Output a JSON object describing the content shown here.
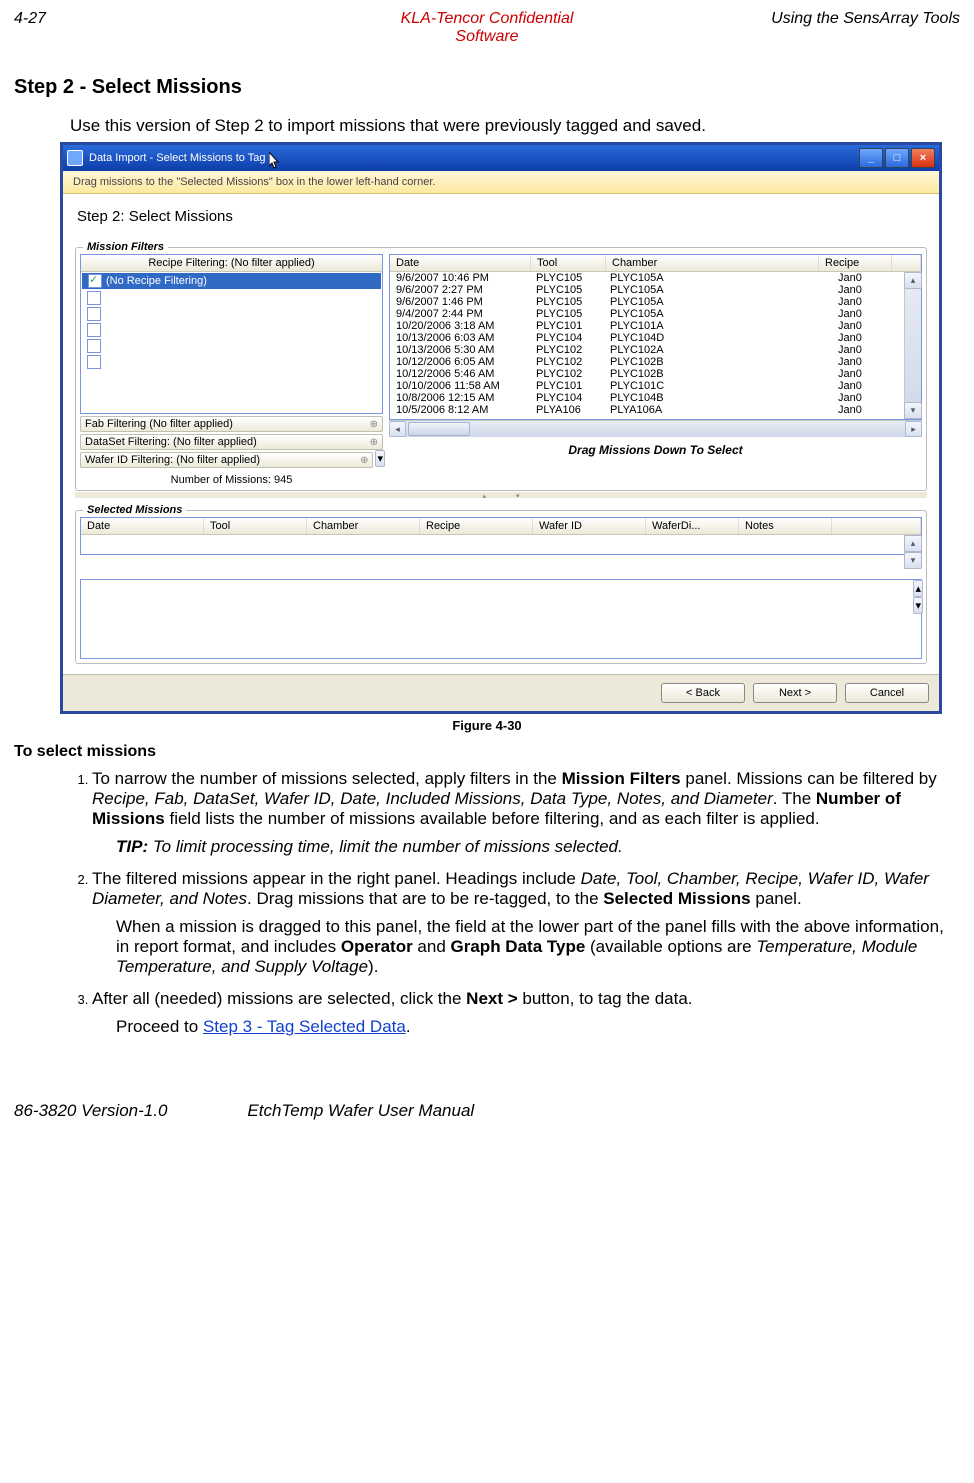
{
  "header": {
    "page_no": "4-27",
    "center_line1": "KLA-Tencor Confidential",
    "center_line2": "Software",
    "right": "Using the SensArray Tools"
  },
  "title": "Step 2 - Select Missions",
  "intro": "Use this version of Step 2 to import missions that were previously tagged and saved.",
  "window": {
    "title": "Data Import - Select Missions to Tag",
    "info_banner": "Drag missions to the \"Selected Missions\" box in the lower left-hand corner.",
    "step_label": "Step 2: Select Missions",
    "filters_legend": "Mission Filters",
    "recipe_filter_header": "Recipe Filtering: (No filter applied)",
    "recipe_selected": "(No Recipe Filtering)",
    "fab_filter": "Fab Filtering (No filter applied)",
    "dataset_filter": "DataSet Filtering: (No filter applied)",
    "waferid_filter": "Wafer ID Filtering: (No filter applied)",
    "num_missions": "Number of Missions: 945",
    "mcols": {
      "date": "Date",
      "tool": "Tool",
      "chamber": "Chamber",
      "recipe": "Recipe"
    },
    "rows": [
      {
        "date": "9/6/2007 10:46 PM",
        "tool": "PLYC105",
        "chamber": "PLYC105A",
        "recipe": "Jan0"
      },
      {
        "date": "9/6/2007 2:27 PM",
        "tool": "PLYC105",
        "chamber": "PLYC105A",
        "recipe": "Jan0"
      },
      {
        "date": "9/6/2007 1:46 PM",
        "tool": "PLYC105",
        "chamber": "PLYC105A",
        "recipe": "Jan0"
      },
      {
        "date": "9/4/2007 2:44 PM",
        "tool": "PLYC105",
        "chamber": "PLYC105A",
        "recipe": "Jan0"
      },
      {
        "date": "10/20/2006 3:18 AM",
        "tool": "PLYC101",
        "chamber": "PLYC101A",
        "recipe": "Jan0"
      },
      {
        "date": "10/13/2006 6:03 AM",
        "tool": "PLYC104",
        "chamber": "PLYC104D",
        "recipe": "Jan0"
      },
      {
        "date": "10/13/2006 5:30 AM",
        "tool": "PLYC102",
        "chamber": "PLYC102A",
        "recipe": "Jan0"
      },
      {
        "date": "10/12/2006 6:05 AM",
        "tool": "PLYC102",
        "chamber": "PLYC102B",
        "recipe": "Jan0"
      },
      {
        "date": "10/12/2006 5:46 AM",
        "tool": "PLYC102",
        "chamber": "PLYC102B",
        "recipe": "Jan0"
      },
      {
        "date": "10/10/2006 11:58 AM",
        "tool": "PLYC101",
        "chamber": "PLYC101C",
        "recipe": "Jan0"
      },
      {
        "date": "10/8/2006 12:15 AM",
        "tool": "PLYC104",
        "chamber": "PLYC104B",
        "recipe": "Jan0"
      },
      {
        "date": "10/5/2006 8:12 AM",
        "tool": "PLYA106",
        "chamber": "PLYA106A",
        "recipe": "Jan0"
      }
    ],
    "drag_hint": "Drag Missions Down To Select",
    "selected_legend": "Selected Missions",
    "scols": {
      "date": "Date",
      "tool": "Tool",
      "chamber": "Chamber",
      "recipe": "Recipe",
      "waferid": "Wafer ID",
      "waferdi": "WaferDi...",
      "notes": "Notes"
    },
    "buttons": {
      "back": "< Back",
      "next": "Next >",
      "cancel": "Cancel"
    }
  },
  "figure_caption": "Figure 4-30",
  "subhead": "To select missions",
  "steps": {
    "s1a": "To narrow the number of missions selected, apply filters in the ",
    "s1b": "Mission Filters",
    "s1c": " panel. Missions can be filtered by ",
    "s1_list": "Recipe, Fab, DataSet, Wafer ID, Date, Included Missions, Data Type, Notes, and Diameter",
    "s1d": ". The ",
    "s1e": "Number of Missions",
    "s1f": " field lists the number of missions available before filtering, and as each filter is applied.",
    "tip_label": "TIP:",
    "tip_text": " To limit processing time, limit the number of missions selected.",
    "s2a": "The filtered missions appear in the right panel. Headings include ",
    "s2_list": "Date, Tool, Chamber, Recipe, Wafer ID, Wafer Diameter, and Notes",
    "s2b": ". Drag missions that are to be re-tagged, to the ",
    "s2c": "Selected Missions",
    "s2d": " panel.",
    "s2e": "When a mission is dragged to this panel, the field at the lower part of the panel fills with the above information, in report format, and includes ",
    "s2f": "Operator",
    "s2g": " and ",
    "s2h": "Graph Data Type",
    "s2i": " (available options are ",
    "s2_opts": "Temperature, Module Temperature, and Supply Voltage",
    "s2j": ").",
    "s3a": "After all (needed) missions are selected, click the ",
    "s3b": "Next >",
    "s3c": " button, to tag the data.",
    "s3d": "Proceed to ",
    "s3_link": "Step 3 - Tag Selected Data",
    "s3e": "."
  },
  "footer": {
    "left": "86-3820 Version-1.0",
    "right": "EtchTemp Wafer User Manual"
  }
}
